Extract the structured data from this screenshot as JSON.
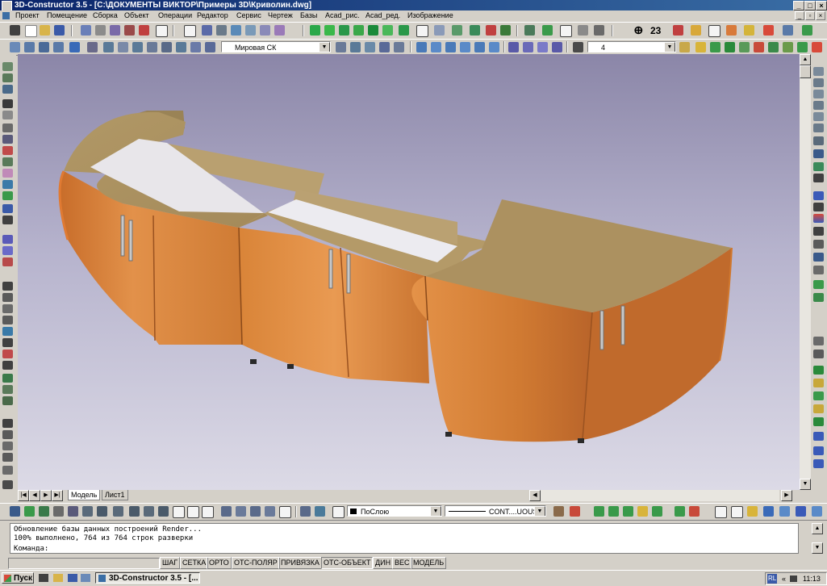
{
  "window": {
    "title": "3D-Constructor 3.5 - [C:\\ДОКУМЕНТЫ ВИКТОР\\Примеры 3D\\Криволин.dwg]",
    "min": "_",
    "max": "□",
    "close": "×"
  },
  "menu": [
    "Проект",
    "Помещение",
    "Сборка",
    "Объект",
    "Операции",
    "Редактор",
    "Сервис",
    "Чертеж",
    "Базы",
    "Acad_рис.",
    "Acad_ред.",
    "Изображение"
  ],
  "toolbar2": {
    "ucs_combo": "Мировая СК",
    "layer_combo": "4"
  },
  "toolbar_text": {
    "a": "ⴲ",
    "b": "23"
  },
  "layout_tabs": [
    "Модель",
    "Лист1"
  ],
  "props_bar": {
    "color_combo": "ПоСлою",
    "linetype_combo": "CONT....UOUS"
  },
  "command": {
    "line1": "Обновление базы данных построений Render...",
    "line2": "100% выполнено, 764 из 764 строк разверки",
    "prompt": "Команда:"
  },
  "status_buttons": [
    "ШАГ",
    "СЕТКА",
    "ОРТО",
    "ОТС-ПОЛЯР",
    "ПРИВЯЗКА",
    "ОТС-ОБЪЕКТ",
    "ДИН",
    "ВЕС",
    "МОДЕЛЬ"
  ],
  "taskbar": {
    "start": "Пуск",
    "task": "3D-Constructor 3.5 - [...",
    "lang": "RL",
    "time": "11:13"
  },
  "colors": {
    "wood_top": "#b49a68",
    "cabinet_orange": "#d9843a",
    "viewport_top": "#8b86a8",
    "viewport_bottom": "#dcdae6"
  }
}
